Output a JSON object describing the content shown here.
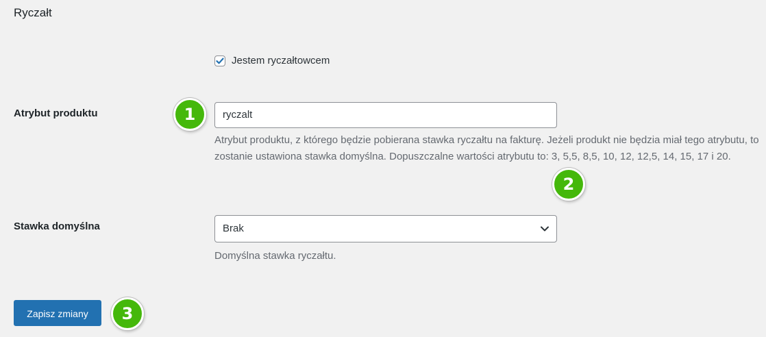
{
  "section": {
    "title": "Ryczałt"
  },
  "checkbox": {
    "label": "Jestem ryczałtowcem",
    "checked": true
  },
  "attribute": {
    "label": "Atrybut produktu",
    "value": "ryczalt",
    "description": "Atrybut produktu, z którego będzie pobierana stawka ryczałtu na fakturę. Jeżeli produkt nie będzia miał tego atrybutu, to zostanie ustawiona stawka domyślna. Dopuszczalne wartości atrybutu to: 3, 5,5, 8,5, 10, 12, 12,5, 14, 15, 17 i 20."
  },
  "default_rate": {
    "label": "Stawka domyślna",
    "selected": "Brak",
    "description": "Domyślna stawka ryczałtu."
  },
  "save_button": {
    "label": "Zapisz zmiany"
  },
  "badges": [
    "1",
    "2",
    "3"
  ],
  "colors": {
    "accent": "#2271b1",
    "badge_green": "#45b80b",
    "background": "#f1f1f1"
  },
  "icons": {
    "checkbox": "checkmark-icon",
    "select": "chevron-down-icon"
  }
}
